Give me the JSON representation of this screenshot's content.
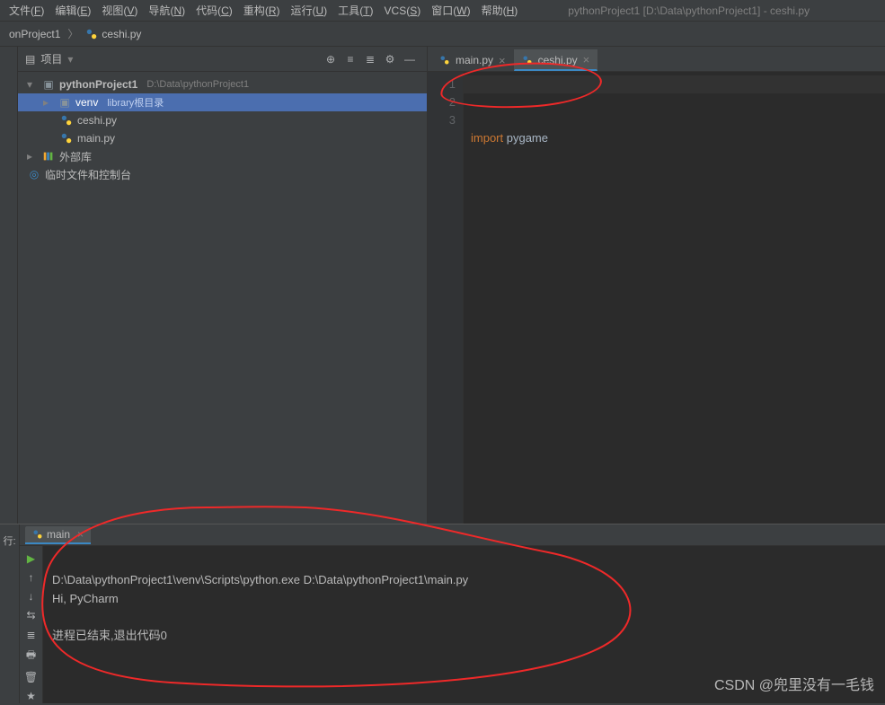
{
  "menubar": {
    "items": [
      {
        "label": "文件",
        "accel": "F"
      },
      {
        "label": "编辑",
        "accel": "E"
      },
      {
        "label": "视图",
        "accel": "V"
      },
      {
        "label": "导航",
        "accel": "N"
      },
      {
        "label": "代码",
        "accel": "C"
      },
      {
        "label": "重构",
        "accel": "R"
      },
      {
        "label": "运行",
        "accel": "U"
      },
      {
        "label": "工具",
        "accel": "T"
      },
      {
        "label": "VCS",
        "accel": "S"
      },
      {
        "label": "窗口",
        "accel": "W"
      },
      {
        "label": "帮助",
        "accel": "H"
      }
    ],
    "window_title": "pythonProject1 [D:\\Data\\pythonProject1] - ceshi.py"
  },
  "breadcrumb": {
    "project": "onProject1",
    "file": "ceshi.py"
  },
  "project_panel": {
    "title": "项目",
    "root": {
      "name": "pythonProject1",
      "hint": "D:\\Data\\pythonProject1"
    },
    "venv": {
      "name": "venv",
      "hint": "library根目录"
    },
    "files": [
      "ceshi.py",
      "main.py"
    ],
    "ext_lib": "外部库",
    "scratch": "临时文件和控制台"
  },
  "editor": {
    "tabs": [
      {
        "name": "main.py",
        "active": false
      },
      {
        "name": "ceshi.py",
        "active": true
      }
    ],
    "lines": [
      "1",
      "2",
      "3"
    ],
    "code_keyword": "import",
    "code_rest": " pygame"
  },
  "run": {
    "label": "行:",
    "tab": "main",
    "output_line1": "D:\\Data\\pythonProject1\\venv\\Scripts\\python.exe D:\\Data\\pythonProject1\\main.py",
    "output_line2": "Hi, PyCharm",
    "output_line3": "进程已结束,退出代码0"
  },
  "watermark": "CSDN @兜里没有一毛钱"
}
